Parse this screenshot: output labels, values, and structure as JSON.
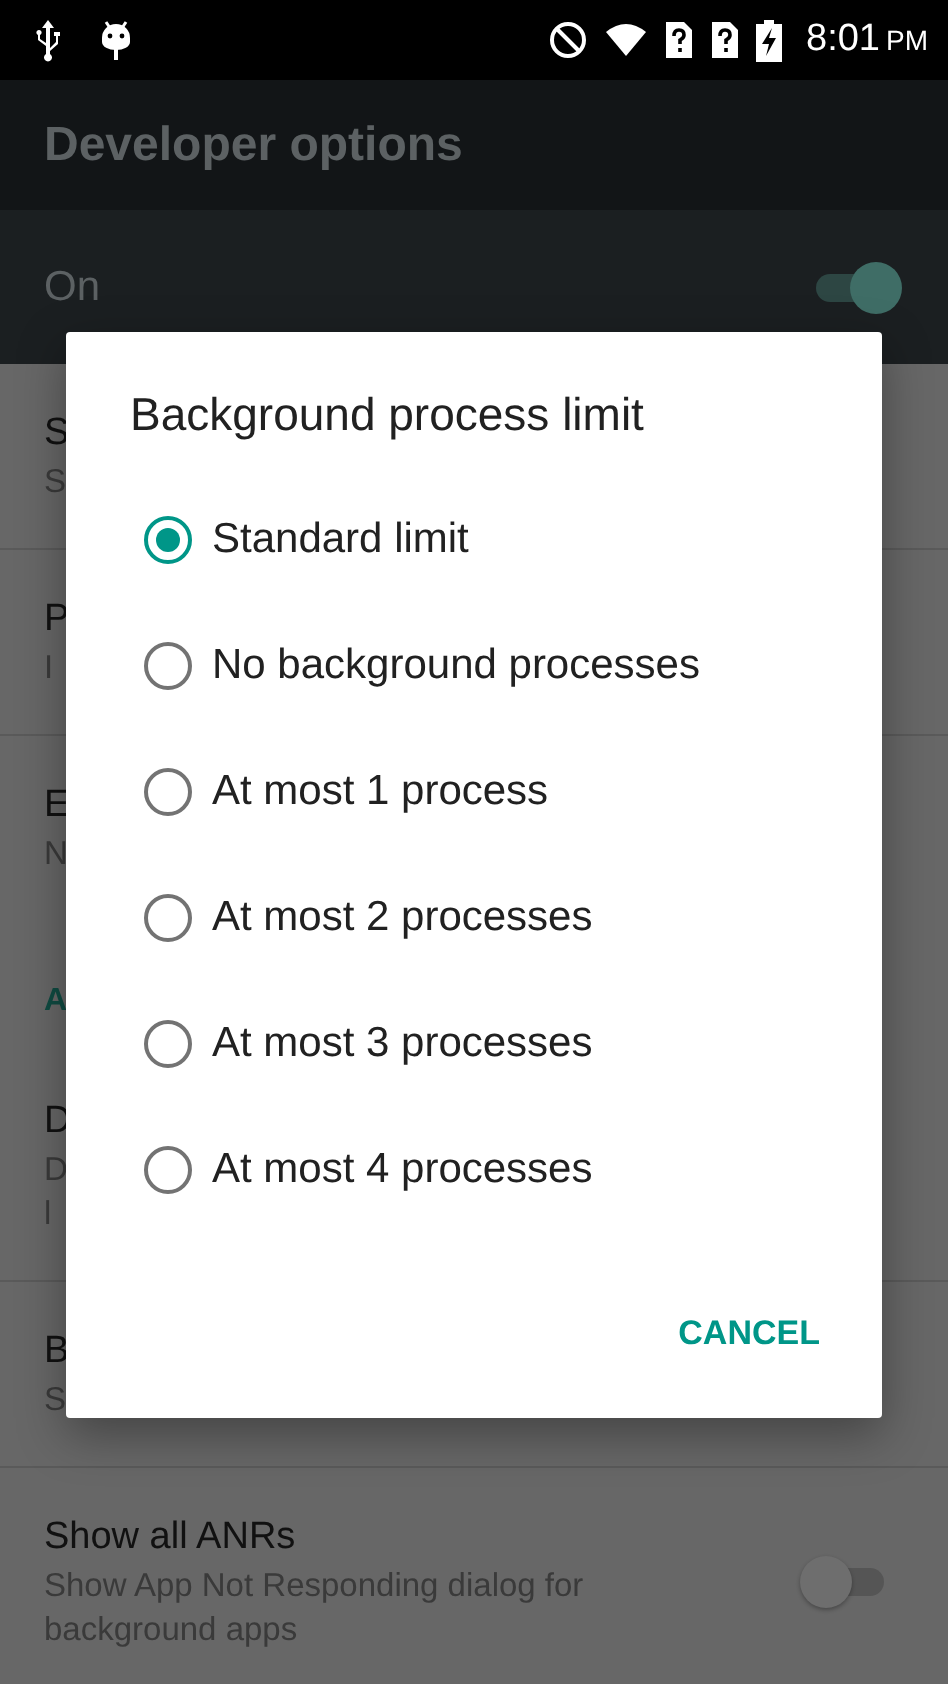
{
  "status_bar": {
    "time": "8:01",
    "meridiem": "PM"
  },
  "app_bar": {
    "title": "Developer options"
  },
  "master_switch": {
    "label": "On",
    "on": true
  },
  "settings": [
    {
      "kind": "item",
      "title": "S",
      "summary": "S"
    },
    {
      "kind": "item",
      "title": "P",
      "summary": "I"
    },
    {
      "kind": "item",
      "title": "E",
      "summary": "N"
    },
    {
      "kind": "category",
      "title": "A"
    },
    {
      "kind": "item",
      "title": "D",
      "summary": "D\nl"
    },
    {
      "kind": "item",
      "title": "B",
      "summary": "S"
    },
    {
      "kind": "switch",
      "title": "Show all ANRs",
      "summary": "Show App Not Responding dialog for background apps",
      "on": false
    }
  ],
  "dialog": {
    "title": "Background process limit",
    "options": [
      {
        "label": "Standard limit",
        "selected": true
      },
      {
        "label": "No background processes",
        "selected": false
      },
      {
        "label": "At most 1 process",
        "selected": false
      },
      {
        "label": "At most 2 processes",
        "selected": false
      },
      {
        "label": "At most 3 processes",
        "selected": false
      },
      {
        "label": "At most 4 processes",
        "selected": false
      }
    ],
    "buttons": [
      "CANCEL"
    ]
  }
}
